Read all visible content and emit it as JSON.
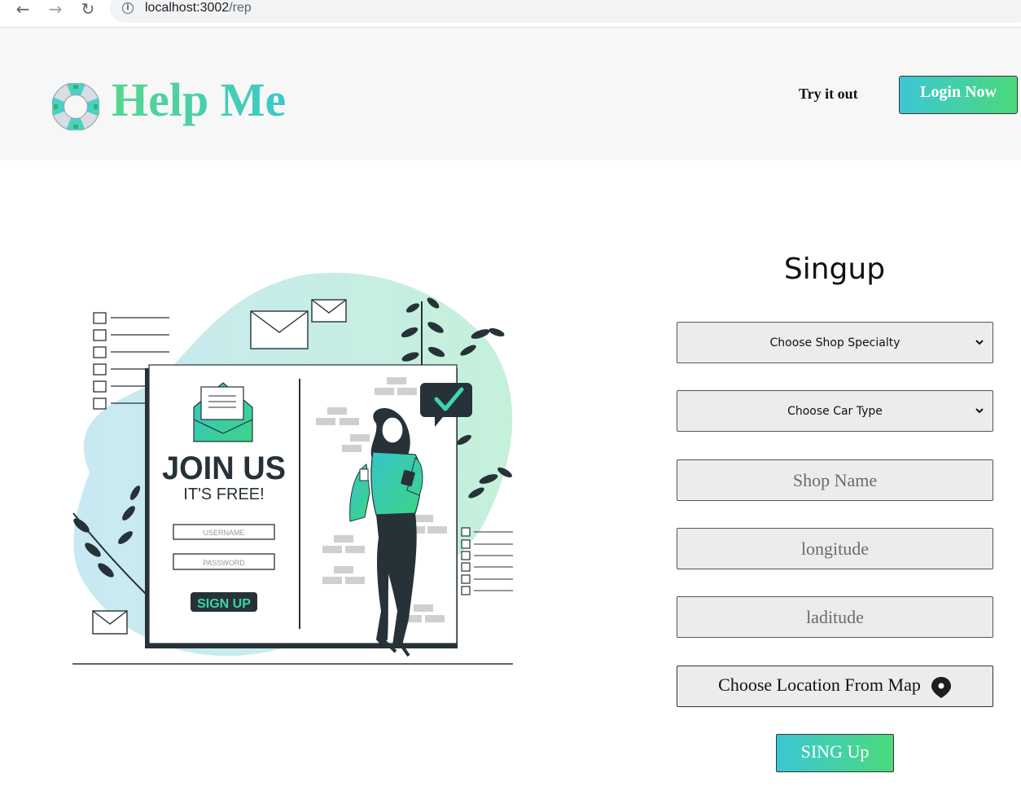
{
  "browser": {
    "url_host": "localhost:3002",
    "url_path": "/rep"
  },
  "header": {
    "brand": "Help Me",
    "try_link": "Try it out",
    "login_button": "Login Now",
    "logo_icon": "lifebuoy-icon"
  },
  "illustration": {
    "join_title": "JOIN US",
    "join_subtitle": "IT'S FREE!",
    "username_label": "USERNAME",
    "password_label": "PASSWORD",
    "signup_label": "SIGN UP"
  },
  "form": {
    "title": "Singup",
    "shop_specialty_select": "Choose Shop Specialty",
    "car_type_select": "Choose Car Type",
    "shop_name_placeholder": "Shop Name",
    "longitude_placeholder": "longitude",
    "latitude_placeholder": "laditude",
    "map_button": "Choose Location From Map",
    "map_icon": "map-pin-icon",
    "submit_button": "SING Up"
  },
  "colors": {
    "accent_teal": "#3cc9c8",
    "accent_green": "#4cd97b",
    "header_bg": "#f7f7f7",
    "field_bg": "#ececec"
  }
}
